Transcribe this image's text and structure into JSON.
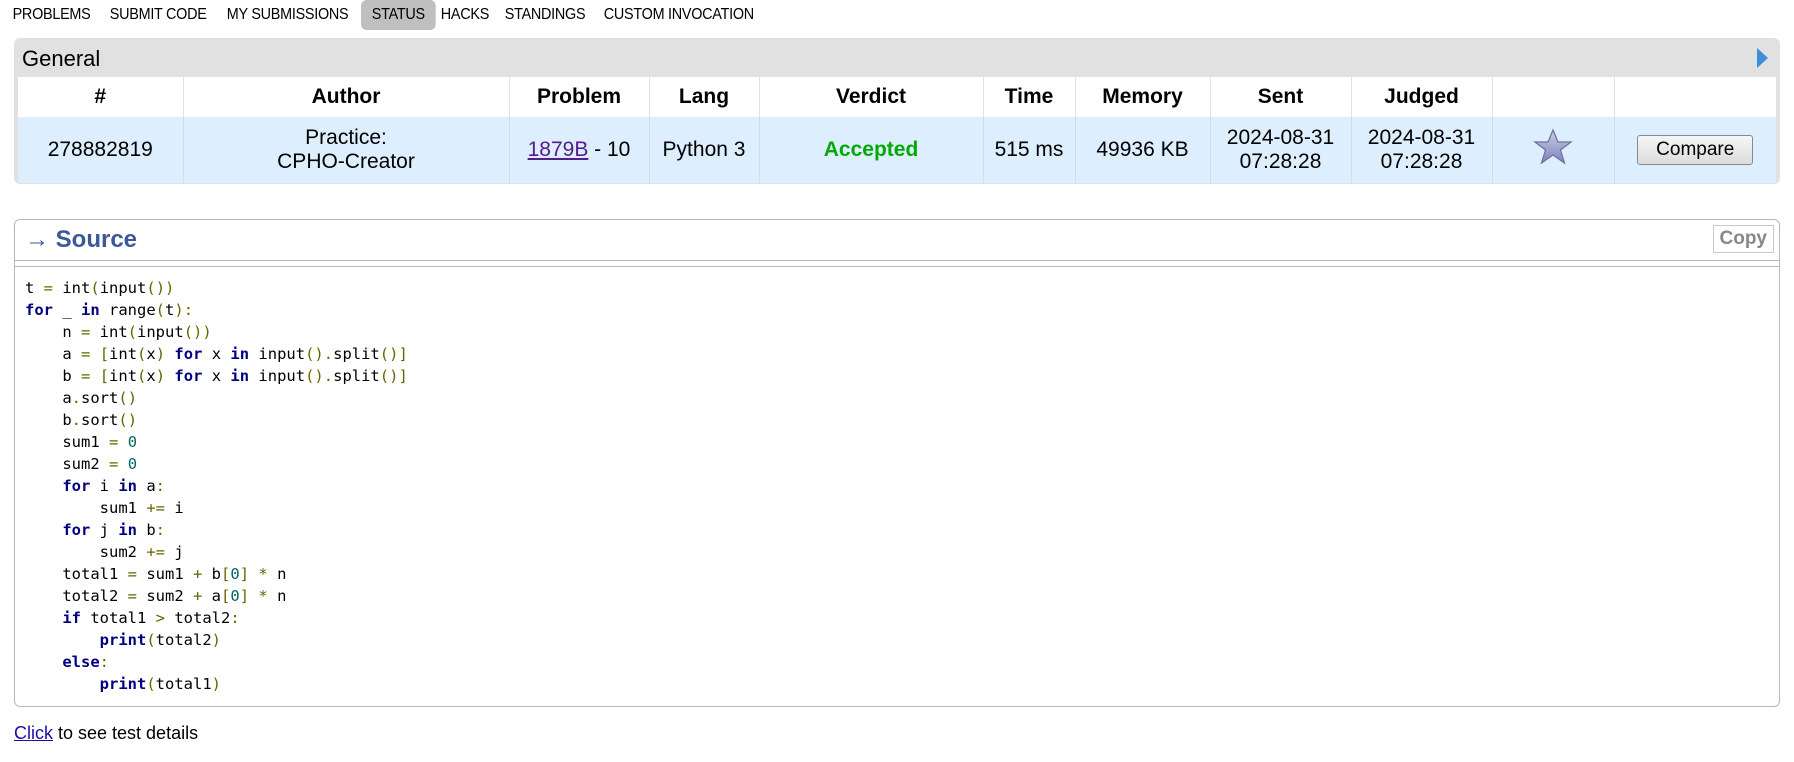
{
  "nav": [
    {
      "label": "PROBLEMS"
    },
    {
      "label": "SUBMIT CODE"
    },
    {
      "label": "MY SUBMISSIONS"
    },
    {
      "label": "STATUS",
      "active": true
    },
    {
      "label": "HACKS"
    },
    {
      "label": "STANDINGS"
    },
    {
      "label": "CUSTOM INVOCATION"
    }
  ],
  "general": {
    "title": "General",
    "columns": [
      "#",
      "Author",
      "Problem",
      "Lang",
      "Verdict",
      "Time",
      "Memory",
      "Sent",
      "Judged",
      "",
      ""
    ],
    "row": {
      "id": "278882819",
      "author_line1": "Practice:",
      "author_line2": "CPHO-Creator",
      "problem_link": "1879B",
      "problem_suffix": " - 10",
      "lang": "Python 3",
      "verdict": "Accepted",
      "verdict_color": "#00aa00",
      "time": "515 ms",
      "memory": "49936 KB",
      "sent_date": "2024-08-31",
      "sent_time": "07:28:28",
      "judged_date": "2024-08-31",
      "judged_time": "07:28:28",
      "star_icon": "star-icon",
      "compare_label": "Compare"
    }
  },
  "source": {
    "title": "→ Source",
    "copy_label": "Copy",
    "code_lines": [
      "t = int(input())",
      "for _ in range(t):",
      "    n = int(input())",
      "    a = [int(x) for x in input().split()]",
      "    b = [int(x) for x in input().split()]",
      "    a.sort()",
      "    b.sort()",
      "    sum1 = 0",
      "    sum2 = 0",
      "    for i in a:",
      "        sum1 += i",
      "    for j in b:",
      "        sum2 += j",
      "    total1 = sum1 + b[0] * n",
      "    total2 = sum2 + a[0] * n",
      "    if total1 > total2:",
      "        print(total2)",
      "    else:",
      "        print(total1)"
    ]
  },
  "footer": {
    "link": "Click",
    "text": " to see test details"
  }
}
